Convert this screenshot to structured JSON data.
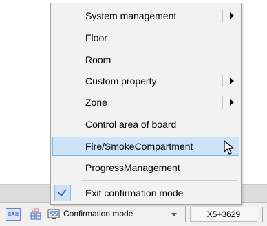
{
  "menu": {
    "items": [
      {
        "label": "System management",
        "submenu": true
      },
      {
        "label": "Floor",
        "submenu": false
      },
      {
        "label": "Room",
        "submenu": false
      },
      {
        "label": "Custom property",
        "submenu": true
      },
      {
        "label": "Zone",
        "submenu": true
      },
      {
        "label": "Control area of board",
        "submenu": false
      },
      {
        "label": "Fire/SmokeCompartment",
        "submenu": false,
        "highlighted": true
      },
      {
        "label": "ProgressManagement",
        "submenu": false
      },
      {
        "label": "Exit confirmation mode",
        "submenu": false,
        "checked": true
      }
    ]
  },
  "status_bar": {
    "mode_icon_text": "≡X≡",
    "mode_label": "Confirmation mode",
    "coordinate": "X5+3629"
  },
  "colors": {
    "highlight_bg": "#cde3f7",
    "highlight_border": "#7db2e3",
    "check": "#2a63c4"
  }
}
